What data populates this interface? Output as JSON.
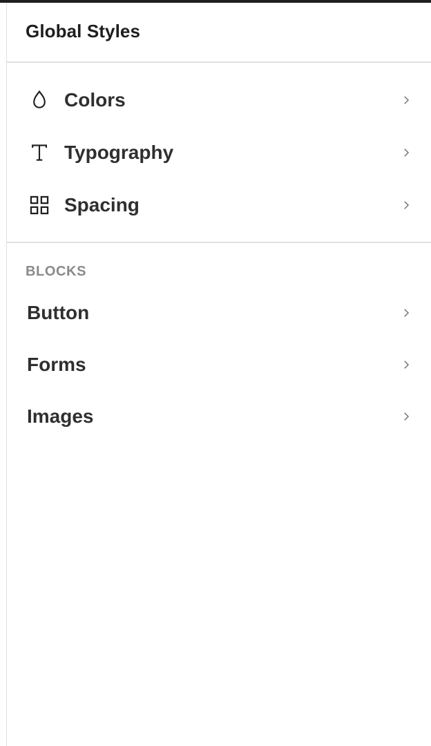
{
  "header": {
    "title": "Global Styles"
  },
  "general": {
    "items": [
      {
        "label": "Colors",
        "icon": "droplet-icon"
      },
      {
        "label": "Typography",
        "icon": "typography-icon"
      },
      {
        "label": "Spacing",
        "icon": "grid-layout-icon"
      }
    ]
  },
  "blocks": {
    "heading": "BLOCKS",
    "items": [
      {
        "label": "Button"
      },
      {
        "label": "Forms"
      },
      {
        "label": "Images"
      }
    ]
  },
  "colors": {
    "text": "#1e1e1e",
    "muted": "#8a8a8a",
    "chevron": "#757575",
    "divider": "#e0e0e0"
  }
}
